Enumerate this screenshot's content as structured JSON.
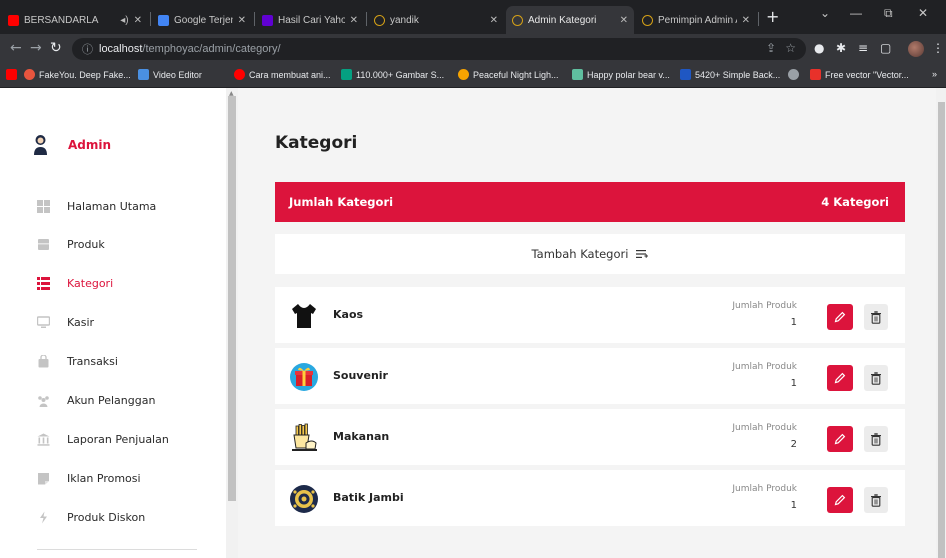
{
  "browser": {
    "tabs": [
      {
        "label": "BERSANDARLA",
        "favicon_color": "#ff0000",
        "icon": "youtube-icon",
        "audio": true
      },
      {
        "label": "Google Terjemahan",
        "favicon_color": "#4285f4",
        "icon": "google-translate-icon"
      },
      {
        "label": "Hasil Cari Yahoo un",
        "favicon_color": "#6001d2",
        "icon": "yahoo-icon"
      },
      {
        "label": "yandik",
        "favicon_color": "#d4a017",
        "icon": "loading-icon"
      },
      {
        "label": "Admin Kategori",
        "favicon_color": "#d4a017",
        "icon": "loading-icon",
        "active": true
      },
      {
        "label": "Pemimpin Admin A",
        "favicon_color": "#d4a017",
        "icon": "loading-icon"
      }
    ],
    "address": {
      "host": "localhost",
      "path": "/temphoyac/admin/category/"
    },
    "bookmarks": [
      {
        "label": "FakeYou. Deep Fake...",
        "color": "#e8553e"
      },
      {
        "label": "Video Editor",
        "color": "#4a90e2"
      },
      {
        "label": "Cara membuat ani...",
        "color": "#ff0000"
      },
      {
        "label": "110.000+ Gambar S...",
        "color": "#05a081"
      },
      {
        "label": "Peaceful Night Ligh...",
        "color": "#f7a400"
      },
      {
        "label": "Happy polar bear v...",
        "color": "#5fbf9f"
      },
      {
        "label": "5420+ Simple Back...",
        "color": "#1f57c3"
      },
      {
        "label": "",
        "color": "#9aa0a6"
      },
      {
        "label": "Free vector \"Vector...",
        "color": "#e8312a"
      }
    ]
  },
  "sidebar": {
    "brand": "Admin",
    "items": [
      {
        "label": "Halaman Utama",
        "icon": "grid-icon"
      },
      {
        "label": "Produk",
        "icon": "box-icon"
      },
      {
        "label": "Kategori",
        "icon": "list-icon",
        "active": true
      },
      {
        "label": "Kasir",
        "icon": "monitor-icon"
      },
      {
        "label": "Transaksi",
        "icon": "bag-icon"
      },
      {
        "label": "Akun Pelanggan",
        "icon": "users-icon"
      },
      {
        "label": "Laporan Penjualan",
        "icon": "bank-icon"
      },
      {
        "label": "Iklan Promosi",
        "icon": "promo-icon"
      },
      {
        "label": "Produk Diskon",
        "icon": "discount-icon"
      }
    ]
  },
  "main": {
    "title": "Kategori",
    "count_label": "Jumlah Kategori",
    "count_value": "4 Kategori",
    "add_label": "Tambah Kategori",
    "product_label": "Jumlah Produk",
    "categories": [
      {
        "name": "Kaos",
        "count": "1",
        "icon": "tshirt-icon"
      },
      {
        "name": "Souvenir",
        "count": "1",
        "icon": "gift-icon"
      },
      {
        "name": "Makanan",
        "count": "2",
        "icon": "fries-icon"
      },
      {
        "name": "Batik Jambi",
        "count": "1",
        "icon": "batik-icon"
      }
    ]
  },
  "colors": {
    "accent": "#dc143c",
    "page_bg": "#f4f4f4"
  }
}
